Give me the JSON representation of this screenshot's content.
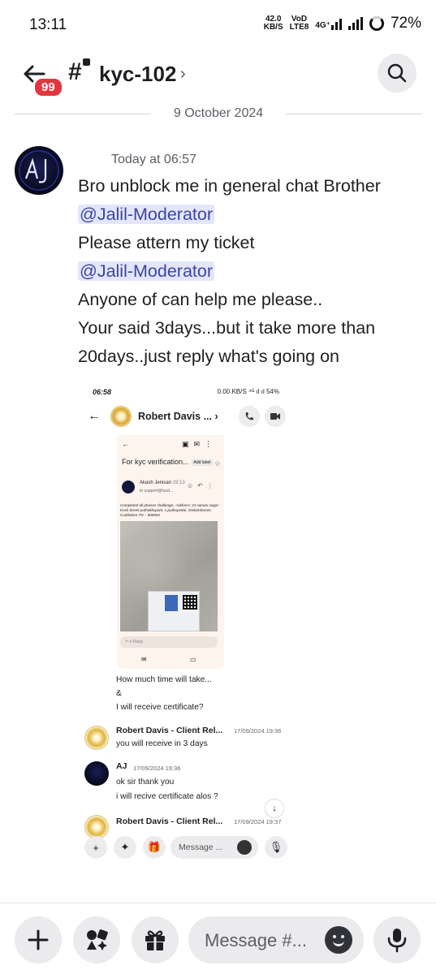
{
  "status_bar": {
    "time": "13:11",
    "net_speed_value": "42.0",
    "net_speed_unit": "KB/S",
    "volte_top": "VoD",
    "volte_bottom": "LTE8",
    "network": "4G⁺",
    "battery": "72%"
  },
  "header": {
    "unread_badge": "99",
    "channel_name": "kyc-102",
    "chevron": "›"
  },
  "date_divider": "9 October 2024",
  "message": {
    "timestamp": "Today at 06:57",
    "line1": "Bro unblock me in general chat Brother",
    "mention1": "@Jalil-Moderator",
    "line2": "Please attern my ticket",
    "mention2": "@Jalil-Moderator",
    "line3": "Anyone of can help me please..",
    "line4": "Your said 3days...but it take more than",
    "line5": "20days..just reply what's going on"
  },
  "attachment": {
    "time": "06:58",
    "status_right": "0.00 KB/S  ⁴ᴳ ıl ıl 54%",
    "dm_name": "Robert Davis ... ›",
    "email": {
      "subject": "For kyc verification...",
      "tag": "Add label",
      "sender": "Akash Jenisan",
      "sender_time": "19:13",
      "to": "to support@fund...",
      "body": "Completed all phases challenge.. Address: 23 sanani nagar Kovil Street puthukkupam, c.puthupettai, chidambaram, Cuddalore,TN – 608502",
      "reply": "Reply"
    },
    "caption_line1": "How much time will take...",
    "caption_line2": "&",
    "caption_line3": "I will receive certificate?",
    "msg1": {
      "author": "Robert Davis - Client Rel...",
      "time": "17/09/2024 19:36",
      "text": "you will receive in 3 days"
    },
    "msg2": {
      "author": "AJ",
      "time": "17/09/2024 19:36",
      "text1": "ok sir thank you",
      "text2": "i will recive certificate alos ?"
    },
    "msg3": {
      "author": "Robert Davis - Client Rel...",
      "time": "17/09/2024 19:37"
    },
    "composer_placeholder": "Message ..."
  },
  "composer": {
    "placeholder": "Message #..."
  }
}
